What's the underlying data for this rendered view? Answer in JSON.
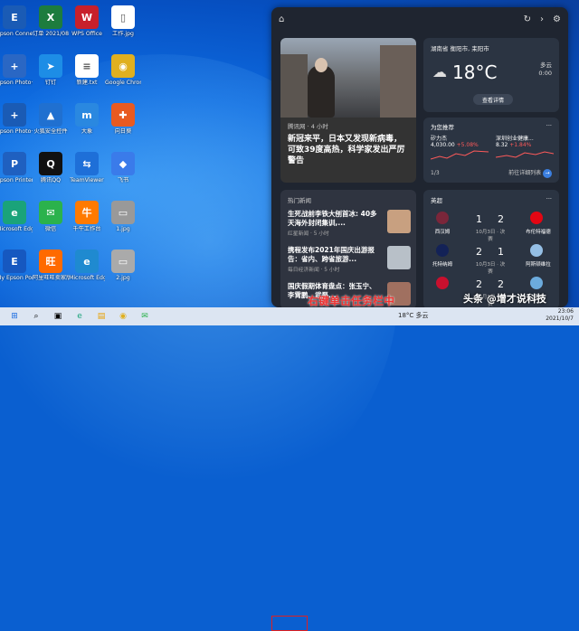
{
  "desktop": {
    "icons": [
      {
        "label": "Epson Connect Se...",
        "glyph": "E",
        "color": "#1a5bb5",
        "col": 0,
        "row": 0
      },
      {
        "label": "订单 2021/08...",
        "glyph": "X",
        "color": "#1d7c3e",
        "col": 1,
        "row": 0
      },
      {
        "label": "WPS Office",
        "glyph": "W",
        "color": "#c8202b",
        "col": 2,
        "row": 0
      },
      {
        "label": "工作.jpg",
        "glyph": "▯",
        "color": "#ffffff",
        "col": 3,
        "row": 0
      },
      {
        "label": "Epson Photo+ C...",
        "glyph": "+",
        "color": "#2a67c4",
        "col": 0,
        "row": 1
      },
      {
        "label": "钉钉",
        "glyph": "➤",
        "color": "#1d8de6",
        "col": 1,
        "row": 1
      },
      {
        "label": "新建.txt",
        "glyph": "≡",
        "color": "#ffffff",
        "col": 2,
        "row": 1
      },
      {
        "label": "Google Chrome",
        "glyph": "◉",
        "color": "#e0b020",
        "col": 3,
        "row": 1
      },
      {
        "label": "Epson Photo+",
        "glyph": "+",
        "color": "#1a5bb5",
        "col": 0,
        "row": 2
      },
      {
        "label": "火狐安全控件",
        "glyph": "▲",
        "color": "#2070d0",
        "col": 1,
        "row": 2
      },
      {
        "label": "大象",
        "glyph": "m",
        "color": "#2a88e0",
        "col": 2,
        "row": 2
      },
      {
        "label": "向日葵",
        "glyph": "✚",
        "color": "#e85a20",
        "col": 3,
        "row": 2
      },
      {
        "label": "Epson Printer C...",
        "glyph": "P",
        "color": "#1f60c0",
        "col": 0,
        "row": 3
      },
      {
        "label": "腾讯QQ",
        "glyph": "Q",
        "color": "#111111",
        "col": 1,
        "row": 3
      },
      {
        "label": "TeamViewer",
        "glyph": "⇆",
        "color": "#1e6fd8",
        "col": 2,
        "row": 3
      },
      {
        "label": "飞书",
        "glyph": "◆",
        "color": "#3a7bea",
        "col": 3,
        "row": 3
      },
      {
        "label": "Microsoft Edge",
        "glyph": "e",
        "color": "#1aa37a",
        "col": 0,
        "row": 4
      },
      {
        "label": "微信",
        "glyph": "✉",
        "color": "#2bb24c",
        "col": 1,
        "row": 4
      },
      {
        "label": "千牛工作台",
        "glyph": "牛",
        "color": "#ff7a00",
        "col": 2,
        "row": 4
      },
      {
        "label": "1.jpg",
        "glyph": "▭",
        "color": "#999999",
        "col": 3,
        "row": 4
      },
      {
        "label": "My Epson Portal",
        "glyph": "E",
        "color": "#1658c0",
        "col": 0,
        "row": 5
      },
      {
        "label": "阿里旺旺卖家版",
        "glyph": "旺",
        "color": "#ff6a00",
        "col": 1,
        "row": 5
      },
      {
        "label": "Microsoft Edge Beta",
        "glyph": "e",
        "color": "#1f8ad0",
        "col": 2,
        "row": 5
      },
      {
        "label": "2.jpg",
        "glyph": "▭",
        "color": "#aaaaaa",
        "col": 3,
        "row": 5
      }
    ]
  },
  "widgets": {
    "news_big": {
      "source": "腾讯网 · 4 小时",
      "title": "新冠来平，日本又发现新病毒，可致39度高热，科学家发出严厉警告"
    },
    "weather": {
      "location": "湖南省 衡阳市, 耒阳市",
      "temp": "18°C",
      "unit": "°C",
      "condition": "多云",
      "detail": "0:00",
      "button": "查看详情"
    },
    "stocks": {
      "title": "为您推荐",
      "items": [
        {
          "name": "矽力杰",
          "value": "4,030.00",
          "change": "+5.08%"
        },
        {
          "name": "深圳创业健康...",
          "value": "8.32",
          "change": "+1.84%"
        }
      ],
      "pager": "1/3",
      "more": "前往详细列表"
    },
    "hot_news": {
      "header": "热门新闻",
      "items": [
        {
          "title": "生死战前李铁大刨首冰: 40多天海外封闭集训,...",
          "sub": "红星新闻 · 5 小时"
        },
        {
          "title": "携程发布2021年国庆出游报告：省内、跨省旅游...",
          "sub": "每日经济新闻 · 5 小时"
        },
        {
          "title": "国庆假期体育盘点：张玉宁、李霄鹏、武磊...",
          "sub": ""
        }
      ]
    },
    "sports": {
      "header": "英超",
      "matches": [
        {
          "home": "西汉姆",
          "away": "布伦特福德",
          "home_score": "1",
          "away_score": "2",
          "date": "10月3日",
          "status": "决赛",
          "home_color": "#7a263a",
          "away_color": "#e30613"
        },
        {
          "home": "托特纳姆",
          "away": "阿斯顿维拉",
          "home_score": "2",
          "away_score": "1",
          "date": "10月3日",
          "status": "决赛",
          "home_color": "#132257",
          "away_color": "#95bfe5"
        },
        {
          "home": "",
          "away": "曼城",
          "home_score": "2",
          "away_score": "2",
          "date": "10月3日",
          "status": "决赛",
          "home_color": "#c8102e",
          "away_color": "#6cabdd"
        }
      ]
    },
    "expand_button": "展开"
  },
  "taskbar": {
    "weather": "18°C 多云",
    "time": "23:06",
    "date": "2021/10/7"
  },
  "overlay": {
    "text": "右键单击任务栏中"
  },
  "watermark": "头条 @增才说科技"
}
